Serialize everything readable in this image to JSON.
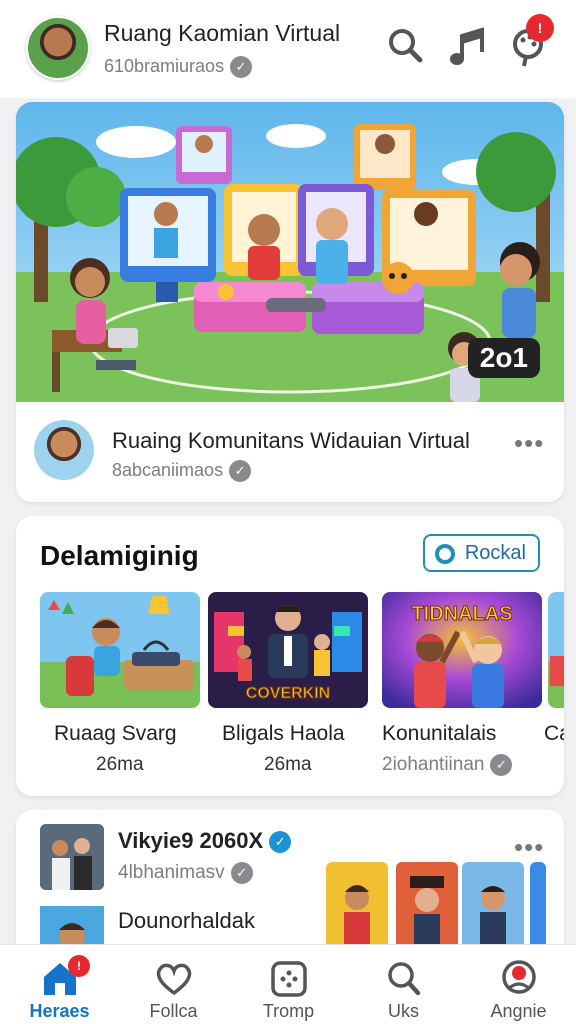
{
  "header": {
    "title": "Ruang Kaomian Virtual",
    "subtitle": "610bramiuraos",
    "notification_badge": "!",
    "icons": [
      "search-icon",
      "music-note-icon",
      "palette-icon"
    ]
  },
  "featured": {
    "image_badge": "2o1",
    "title": "Ruaing Komunitans Widauian Virtual",
    "subtitle": "8abcaniimaos"
  },
  "section": {
    "title": "Delamiginig",
    "button_label": "Rockal",
    "items": [
      {
        "name": "Ruaag Svarg",
        "meta": "26ma"
      },
      {
        "name": "Bligals Haola",
        "meta": "26ma",
        "art_text": "COVERKIN"
      },
      {
        "name": "Konunitalais",
        "meta": "2iohantiinan",
        "art_text": "TIDNALAS"
      },
      {
        "name": "Ca",
        "meta": ""
      }
    ]
  },
  "feed": {
    "title": "Vikyie9 2060X",
    "subtitle": "4lbhanimasv",
    "second_title": "Dounorhaldak"
  },
  "bottom_nav": {
    "items": [
      {
        "label": "Heraes",
        "icon": "home-icon",
        "active": true,
        "badge": "!"
      },
      {
        "label": "Follca",
        "icon": "heart-icon"
      },
      {
        "label": "Tromp",
        "icon": "gamepad-icon"
      },
      {
        "label": "Uks",
        "icon": "search-icon"
      },
      {
        "label": "Angnie",
        "icon": "profile-icon"
      }
    ]
  },
  "colors": {
    "accent": "#1574c8",
    "badge": "#e5292e",
    "verified_blue": "#1e90d6"
  }
}
